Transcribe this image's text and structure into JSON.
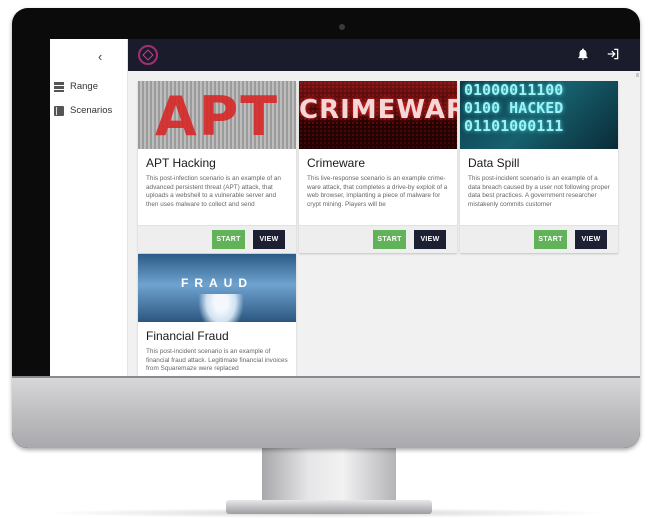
{
  "sidebar": {
    "collapse_glyph": "‹",
    "items": [
      {
        "label": "Range",
        "icon": "range-icon"
      },
      {
        "label": "Scenarios",
        "icon": "book-icon"
      }
    ]
  },
  "topbar": {
    "logo": "app-logo",
    "icons": [
      "bell-icon",
      "exit-icon"
    ]
  },
  "cards": [
    {
      "title": "APT Hacking",
      "image_text": "APT",
      "description": "This post-infection scenario is an example of an advanced persistent threat (APT) attack, that uploads a webshell to a vulnerable server and then uses malware to collect and send",
      "start_label": "START",
      "view_label": "VIEW"
    },
    {
      "title": "Crimeware",
      "image_text": "CRIMEWARE",
      "description": "This live-response scenario is an example crime-ware attack, that completes a drive-by exploit of a web browser, implanting a piece of malware for crypt mining. Players will be",
      "start_label": "START",
      "view_label": "VIEW"
    },
    {
      "title": "Data Spill",
      "image_text": "01000011100\n0100 HACKED\n01101000111",
      "description": "This post-incident scenario is an example of a data breach caused by a user not following proper data best practices. A government researcher mistakenly commits customer",
      "start_label": "START",
      "view_label": "VIEW"
    },
    {
      "title": "Financial Fraud",
      "image_text": "FRAUD",
      "description": "This post-incident scenario is an example of financial fraud attack. Legitimate financial invoices from Squaremaze were replaced"
    }
  ],
  "colors": {
    "topbar": "#1b1c2b",
    "start_button": "#62b25a",
    "view_button": "#1d1f33",
    "logo_accent": "#a0306e"
  }
}
